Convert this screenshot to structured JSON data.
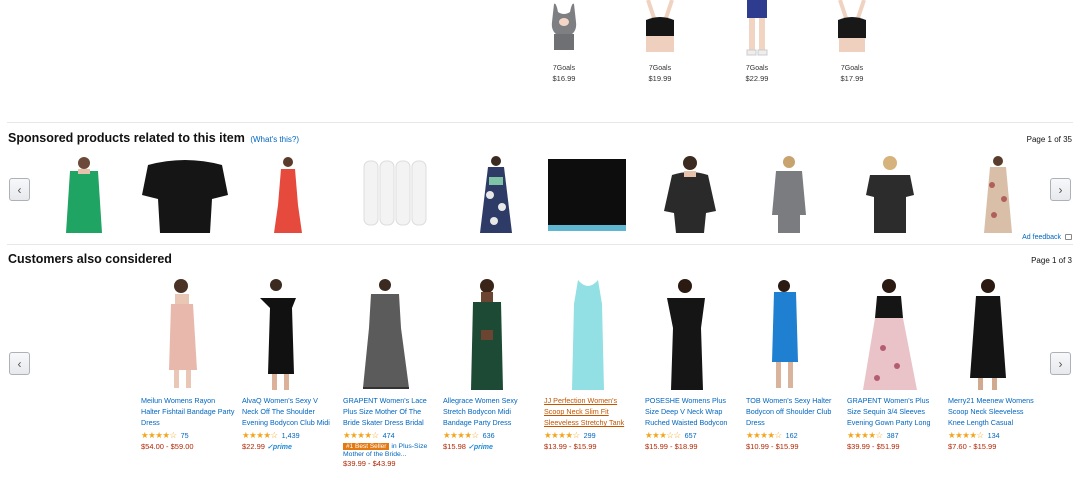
{
  "top_items": [
    {
      "brand": "7Goals",
      "price": "$16.99",
      "icon": "sports-bra-gray-image"
    },
    {
      "brand": "7Goals",
      "price": "$19.99",
      "icon": "sports-bra-black-image"
    },
    {
      "brand": "7Goals",
      "price": "$22.99",
      "icon": "shorts-model-image"
    },
    {
      "brand": "7Goals",
      "price": "$17.99",
      "icon": "sports-bra-black-image"
    }
  ],
  "sponsored": {
    "title": "Sponsored products related to this item",
    "whats_this": "(What's this?)",
    "page": "Page 1 of 35",
    "ad_feedback": "Ad feedback",
    "items": [
      {
        "icon": "green-dress-image",
        "color": "#1fa463"
      },
      {
        "icon": "black-top-image",
        "color": "#151515"
      },
      {
        "icon": "red-dress-image",
        "color": "#e64a3d"
      },
      {
        "icon": "white-socks-image",
        "color": "#f0f0f0"
      },
      {
        "icon": "floral-dress-image",
        "color": "#2d3b66"
      },
      {
        "icon": "black-knit-image",
        "color": "#0d0d0d"
      },
      {
        "icon": "black-lace-top-image",
        "color": "#2a2a2a"
      },
      {
        "icon": "gray-top-image",
        "color": "#7a7c80"
      },
      {
        "icon": "black-tee-image",
        "color": "#2c2c2c"
      },
      {
        "icon": "floral-longsleeve-dress-image",
        "color": "#d9bfa8"
      }
    ]
  },
  "considered": {
    "title": "Customers also considered",
    "page": "Page 1 of 3",
    "items": [
      {
        "title": "Meilun Womens Rayon Halter Fishtail Bandage Party Dress",
        "count": "75",
        "price": "$54.00 - $59.00",
        "color": "#e8b8ad"
      },
      {
        "title": "AlvaQ Women's Sexy V Neck Off The Shoulder Evening Bodycon Club Midi Dress",
        "count": "1,439",
        "price": "$22.99",
        "prime": "✓prime",
        "color": "#111111"
      },
      {
        "title": "GRAPENT Women's Lace Plus Size Mother Of The Bride Skater Dress Bridal Wedding Party",
        "count": "474",
        "badge": "#1 Best Seller",
        "badge_suffix": "in Plus-Size",
        "sub": "Mother of the Bride...",
        "price": "$39.99 - $43.99",
        "color": "#5b5b5b"
      },
      {
        "title": "Allegrace Women Sexy Stretch Bodycon Midi Bandage Party Dress",
        "count": "636",
        "price": "$15.98",
        "prime": "✓prime",
        "color": "#1d4a34"
      },
      {
        "title": "JJ Perfection Women's Scoop Neck Slim Fit Sleeveless Stretchy Tank Midi Dress",
        "count": "299",
        "price": "$13.99 - $15.99",
        "color": "#92dfe4",
        "highlight": true
      },
      {
        "title": "POSESHE Womens Plus Size Deep V Neck Wrap Ruched Waisted Bodycon Dress",
        "count": "657",
        "price": "$15.99 - $18.99",
        "color": "#151515"
      },
      {
        "title": "TOB Women's Sexy Halter Bodycon off Shoulder Club Dress",
        "count": "162",
        "price": "$10.99 - $15.99",
        "color": "#1f7fd0"
      },
      {
        "title": "GRAPENT Women's Plus Size Sequin 3/4 Sleeves Evening Gown Party Long Maxi Dress",
        "count": "387",
        "price": "$39.99 - $51.99",
        "color": "#e9c3c8"
      },
      {
        "title": "Merry21 Meenew Womens Scoop Neck Sleeveless Knee Length Casual Bodycon Tank...",
        "count": "134",
        "price": "$7.60 - $15.99",
        "color": "#141414"
      }
    ]
  },
  "icons": {
    "prev": "chevron-left-icon",
    "next": "chevron-right-icon"
  },
  "arrows": {
    "prev": "‹",
    "next": "›"
  },
  "stars": [
    "★★★★☆",
    "★★★★☆",
    "★★★★☆",
    "★★★★☆",
    "★★★★☆",
    "★★★☆☆",
    "★★★★☆",
    "★★★★☆",
    "★★★★☆"
  ]
}
